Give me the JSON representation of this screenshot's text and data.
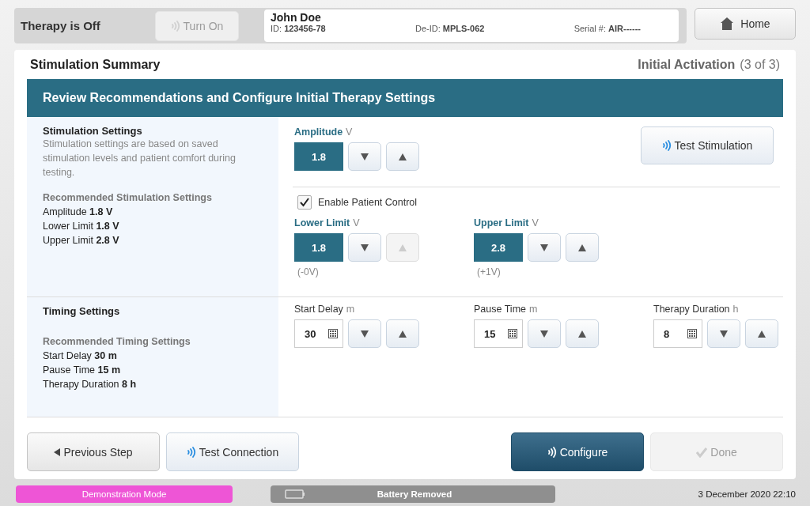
{
  "header": {
    "therapy_status": "Therapy is Off",
    "turn_on": {
      "label": "Turn On",
      "disabled": true
    },
    "patient": {
      "name": "John Doe",
      "fields": [
        {
          "label": "ID:",
          "value": "123456-78"
        },
        {
          "label": "De-ID:",
          "value": "MPLS-062"
        },
        {
          "label": "Serial #:",
          "value": "AIR------"
        }
      ]
    },
    "home": "Home"
  },
  "summary": {
    "title": "Stimulation Summary",
    "step": "Initial Activation",
    "step_count": "(3 of 3)"
  },
  "banner": "Review Recommendations and Configure Initial Therapy Settings",
  "stimulation": {
    "heading": "Stimulation Settings",
    "description": "Stimulation settings are based on saved stimulation levels and patient comfort during testing.",
    "rec_heading": "Recommended Stimulation Settings",
    "rec_items": [
      {
        "label": "Amplitude",
        "value": "1.8 V"
      },
      {
        "label": "Lower Limit",
        "value": "1.8 V"
      },
      {
        "label": "Upper Limit",
        "value": "2.8 V"
      }
    ],
    "amplitude": {
      "label": "Amplitude",
      "unit": "V",
      "value": "1.8",
      "kind": "display",
      "down_disabled": false,
      "up_disabled": false
    },
    "test_button": "Test Stimulation",
    "patient_control": {
      "label": "Enable Patient Control",
      "checked": true
    },
    "limits": [
      {
        "label": "Lower Limit",
        "unit": "V",
        "value": "1.8",
        "kind": "display",
        "note": "(-0V)",
        "down_disabled": false,
        "up_disabled": true
      },
      {
        "label": "Upper Limit",
        "unit": "V",
        "value": "2.8",
        "kind": "display",
        "note": "(+1V)",
        "down_disabled": false,
        "up_disabled": false
      }
    ]
  },
  "timing": {
    "heading": "Timing Settings",
    "rec_heading": "Recommended Timing Settings",
    "rec_items": [
      {
        "label": "Start Delay",
        "value": "30 m"
      },
      {
        "label": "Pause Time",
        "value": "15 m"
      },
      {
        "label": "Therapy Duration",
        "value": "8 h"
      }
    ],
    "controls": [
      {
        "label": "Start Delay",
        "unit": "m",
        "value": "30",
        "kind": "keypad",
        "down_disabled": false,
        "up_disabled": false
      },
      {
        "label": "Pause Time",
        "unit": "m",
        "value": "15",
        "kind": "keypad",
        "down_disabled": false,
        "up_disabled": false
      },
      {
        "label": "Therapy Duration",
        "unit": "h",
        "value": "8",
        "kind": "keypad",
        "down_disabled": false,
        "up_disabled": false
      }
    ]
  },
  "footer_buttons": [
    {
      "label": "Previous Step",
      "kind": "back",
      "disabled": false
    },
    {
      "label": "Test Connection",
      "kind": "signal",
      "disabled": false
    },
    {
      "label": "Configure",
      "kind": "primary",
      "disabled": false
    },
    {
      "label": "Done",
      "kind": "done",
      "disabled": true
    }
  ],
  "status_bar": {
    "mode": "Demonstration Mode",
    "battery": "Battery Removed",
    "datetime": "3 December 2020 22:10"
  }
}
